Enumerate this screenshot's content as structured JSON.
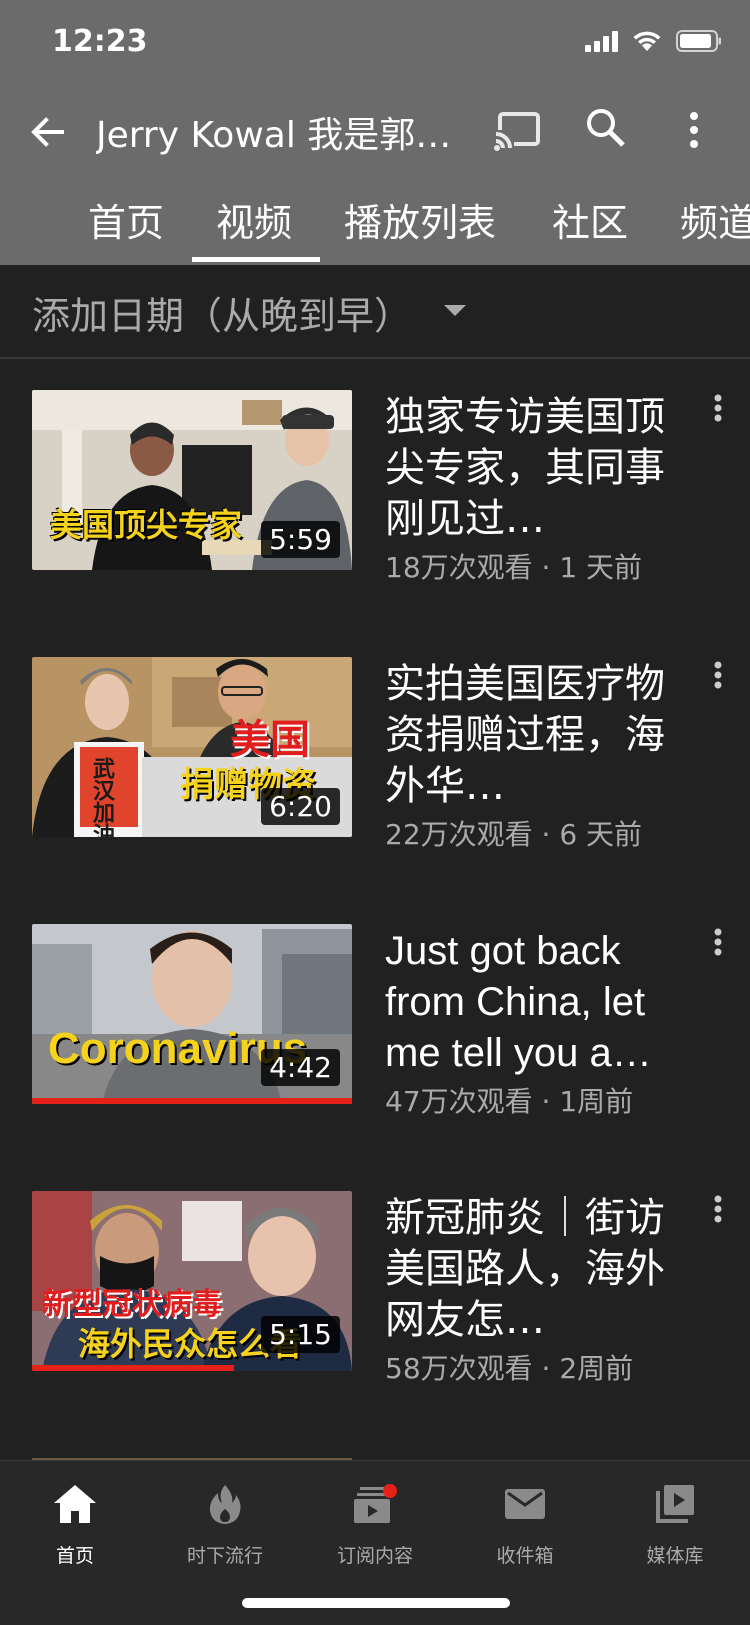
{
  "status_bar": {
    "time": "12:23"
  },
  "app_bar": {
    "title": "Jerry Kowal 我是郭杰瑞"
  },
  "tabs": [
    {
      "label": "首页"
    },
    {
      "label": "视频",
      "active": true
    },
    {
      "label": "播放列表"
    },
    {
      "label": "社区"
    },
    {
      "label": "频道"
    }
  ],
  "sort": {
    "label": "添加日期（从晚到早）"
  },
  "videos": [
    {
      "title": "独家专访美国顶尖专家，其同事刚见过…",
      "meta": "18万次观看 · 1 天前",
      "duration": "5:59",
      "overlay": "美国顶尖专家"
    },
    {
      "title": "实拍美国医疗物资捐赠过程，海外华…",
      "meta": "22万次观看 · 6 天前",
      "duration": "6:20",
      "overlay_top": "美国",
      "overlay_bottom": "捐赠物资",
      "sign": "武汉加油"
    },
    {
      "title": "Just got back from China, let me tell you a…",
      "meta": "47万次观看 · 1周前",
      "duration": "4:42",
      "overlay": "Coronavirus",
      "progress": 1.0
    },
    {
      "title": "新冠肺炎｜街访美国路人，海外网友怎…",
      "meta": "58万次观看 · 2周前",
      "duration": "5:15",
      "overlay_top": "新型冠状病毒",
      "overlay_bottom": "海外民众怎么看",
      "progress": 0.63
    }
  ],
  "bottom_nav": [
    {
      "label": "首页",
      "icon": "home-icon",
      "active": true
    },
    {
      "label": "时下流行",
      "icon": "trending-icon"
    },
    {
      "label": "订阅内容",
      "icon": "subscriptions-icon"
    },
    {
      "label": "收件箱",
      "icon": "inbox-icon"
    },
    {
      "label": "媒体库",
      "icon": "library-icon"
    }
  ],
  "colors": {
    "header_bg": "#6b6b6b",
    "body_bg": "#212121",
    "accent_red": "#e62117",
    "overlay_yellow": "#f5d21b"
  }
}
